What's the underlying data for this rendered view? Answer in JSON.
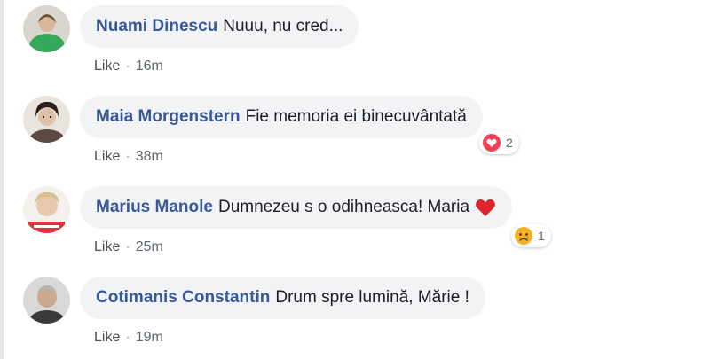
{
  "comments": [
    {
      "author": "Nuami Dinescu",
      "text": "Nuuu, nu cred...",
      "like_label": "Like",
      "separator": "·",
      "time": "16m"
    },
    {
      "author": "Maia Morgenstern",
      "text": "Fie memoria ei binecuvântată",
      "like_label": "Like",
      "separator": "·",
      "time": "38m",
      "reaction": {
        "icon": "heart-reaction-icon",
        "count": "2"
      }
    },
    {
      "author": "Marius Manole",
      "text": "Dumnezeu s o odihneasca! Maria",
      "inline_emoji": "red-heart-icon",
      "like_label": "Like",
      "separator": "·",
      "time": "25m",
      "reaction": {
        "icon": "sad-reaction-icon",
        "count": "1"
      }
    },
    {
      "author": "Cotimanis Constantin",
      "text": "Drum spre lumină, Mărie !",
      "like_label": "Like",
      "separator": "·",
      "time": "19m"
    }
  ],
  "colors": {
    "author": "#385898",
    "bubble": "#f2f3f5",
    "meta": "#606770",
    "heart": "#f33e58",
    "sad": "#f7b125"
  }
}
